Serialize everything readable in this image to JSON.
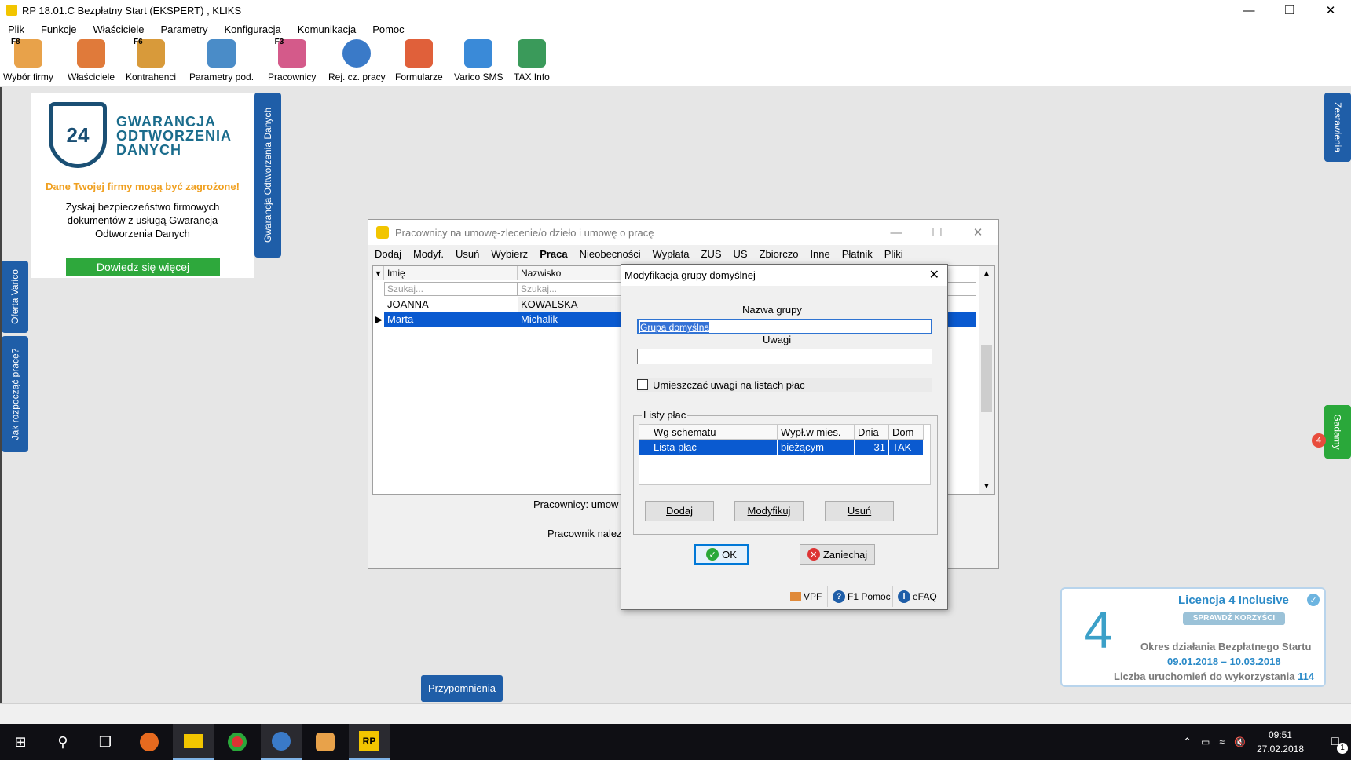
{
  "window": {
    "title": "RP 18.01.C   Bezpłatny Start  (EKSPERT) , KLIKS"
  },
  "menu": [
    "Plik",
    "Funkcje",
    "Właściciele",
    "Parametry",
    "Konfiguracja",
    "Komunikacja",
    "Pomoc"
  ],
  "toolbar": [
    {
      "label": "Wybór firmy",
      "fkey": "F8",
      "icon": "house-icon",
      "color": "#e8a24a"
    },
    {
      "label": "Właściciele",
      "fkey": "",
      "icon": "owners-icon",
      "color": "#e07a3a"
    },
    {
      "label": "Kontrahenci",
      "fkey": "F6",
      "icon": "contractors-icon",
      "color": "#d89a3a"
    },
    {
      "label": "Parametry pod.",
      "fkey": "",
      "icon": "params-icon",
      "color": "#4a8cc8"
    },
    {
      "label": "Pracownicy",
      "fkey": "F3",
      "icon": "employees-icon",
      "color": "#d45a8a"
    },
    {
      "label": "Rej. cz. pracy",
      "fkey": "",
      "icon": "clock-icon",
      "color": "#3a7ac8"
    },
    {
      "label": "Formularze",
      "fkey": "",
      "icon": "forms-icon",
      "color": "#e0603a"
    },
    {
      "label": "Varico SMS",
      "fkey": "",
      "icon": "sms-icon",
      "color": "#3a8ad8"
    },
    {
      "label": "TAX Info",
      "fkey": "",
      "icon": "tax-info-icon",
      "color": "#3a9a5a"
    }
  ],
  "promo": {
    "shield_text": "24",
    "brand": "GWARANCJA\nODTWORZENIA\nDANYCH",
    "warning": "Dane Twojej firmy mogą być zagrożone!",
    "description": "Zyskaj bezpieczeństwo firmowych dokumentów z usługą Gwarancja Odtworzenia Danych",
    "button": "Dowiedz się więcej"
  },
  "side_tabs": {
    "gwarancja": "Gwarancja Odtworzenia Danych",
    "oferta": "Oferta Varico",
    "jak": "Jak rozpocząć pracę?",
    "zestawienia": "Zestawienia",
    "gadamy": "Gadamy",
    "gadamy_badge": "4"
  },
  "main_window": {
    "title": "Pracownicy na umowę-zlecenie/o dzieło i umowę o pracę",
    "menu": [
      "Dodaj",
      "Modyf.",
      "Usuń",
      "Wybierz",
      "Praca",
      "Nieobecności",
      "Wypłata",
      "ZUS",
      "US",
      "Zbiorczo",
      "Inne",
      "Płatnik",
      "Pliki"
    ],
    "columns": [
      "Imię",
      "Nazwisko"
    ],
    "search_placeholder": "Szukaj...",
    "rows": [
      {
        "first": "JOANNA",
        "last": "KOWALSKA"
      },
      {
        "first": "Marta",
        "last": "Michalik"
      }
    ],
    "status1": "Pracownicy: umow",
    "status2": "Pracownik nalez"
  },
  "dialog": {
    "title": "Modyfikacja grupy domyślnej",
    "group_name_label": "Nazwa grupy",
    "group_name_value": "Grupa domyślna",
    "notes_label": "Uwagi",
    "notes_value": "",
    "checkbox_label": "Umieszczać uwagi na listach płac",
    "lists_label": "Listy płac",
    "table_headers": [
      "Wg schematu",
      "Wypł.w mies.",
      "Dnia",
      "Dom"
    ],
    "table_row": {
      "schema": "Lista płac",
      "month": "bieżącym",
      "day": "31",
      "dom": "TAK"
    },
    "btn_add": "Dodaj",
    "btn_modify": "Modyfikuj",
    "btn_delete": "Usuń",
    "btn_ok": "OK",
    "btn_cancel": "Zaniechaj",
    "footer_vpf": "VPF",
    "footer_help": "F1 Pomoc",
    "footer_efaq": "eFAQ"
  },
  "reminders": "Przypomnienia",
  "license": {
    "title": "Licencja 4 Inclusive",
    "button": "SPRAWDŹ KORZYŚCI",
    "period_label": "Okres działania Bezpłatnego Startu",
    "dates": "09.01.2018 – 10.03.2018",
    "count_label": "Liczba uruchomień do wykorzystania",
    "count": "114"
  },
  "taskbar": {
    "time": "09:51",
    "date": "27.02.2018",
    "notifications": "1",
    "rp_label": "RP"
  }
}
